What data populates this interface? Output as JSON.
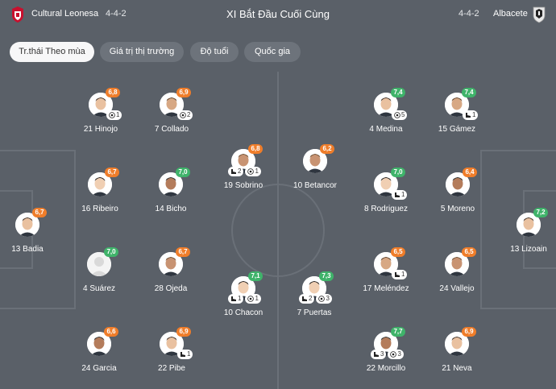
{
  "header": {
    "home_team": "Cultural Leonesa",
    "home_formation": "4-4-2",
    "title": "XI Bắt Đầu Cuối Cùng",
    "away_formation": "4-4-2",
    "away_team": "Albacete"
  },
  "tabs": [
    {
      "label": "Tr.thái Theo mùa",
      "active": true
    },
    {
      "label": "Giá trị thị trường",
      "active": false
    },
    {
      "label": "Độ tuổi",
      "active": false
    },
    {
      "label": "Quốc gia",
      "active": false
    }
  ],
  "colors": {
    "background": "#5a6068",
    "rating_orange": "#ef7d2a",
    "rating_green": "#3fb36a",
    "tab_active": "#f7f7f8",
    "tab_inactive": "#6d737b"
  },
  "home_players": [
    {
      "number_name": "21 Hinojo",
      "rating": "6,8",
      "rating_color": "orange",
      "badges": [
        {
          "icon": "ball-icon",
          "count": "1"
        }
      ]
    },
    {
      "number_name": "7 Collado",
      "rating": "6,9",
      "rating_color": "orange",
      "badges": [
        {
          "icon": "ball-icon",
          "count": "2"
        }
      ]
    },
    {
      "number_name": "19 Sobrino",
      "rating": "6,8",
      "rating_color": "orange",
      "badges": [
        {
          "icon": "boot-icon",
          "count": "2"
        },
        {
          "icon": "ball-icon",
          "count": "1"
        }
      ]
    },
    {
      "number_name": "16 Ribeiro",
      "rating": "6,7",
      "rating_color": "orange",
      "badges": []
    },
    {
      "number_name": "14 Bicho",
      "rating": "7,0",
      "rating_color": "green",
      "badges": []
    },
    {
      "number_name": "13 Badia",
      "rating": "6,7",
      "rating_color": "orange",
      "badges": []
    },
    {
      "number_name": "4 Suárez",
      "rating": "7,0",
      "rating_color": "green",
      "badges": []
    },
    {
      "number_name": "28 Ojeda",
      "rating": "6,7",
      "rating_color": "orange",
      "badges": []
    },
    {
      "number_name": "10 Chacon",
      "rating": "7,1",
      "rating_color": "green",
      "badges": [
        {
          "icon": "boot-icon",
          "count": "1"
        },
        {
          "icon": "ball-icon",
          "count": "1"
        }
      ]
    },
    {
      "number_name": "24 Garcia",
      "rating": "6,6",
      "rating_color": "orange",
      "badges": []
    },
    {
      "number_name": "22 Pibe",
      "rating": "6,9",
      "rating_color": "orange",
      "badges": [
        {
          "icon": "boot-icon",
          "count": "1"
        }
      ]
    }
  ],
  "away_players": [
    {
      "number_name": "4 Medina",
      "rating": "7,4",
      "rating_color": "green",
      "badges": [
        {
          "icon": "ball-icon",
          "count": "5"
        }
      ]
    },
    {
      "number_name": "15 Gámez",
      "rating": "7,4",
      "rating_color": "green",
      "badges": [
        {
          "icon": "boot-icon",
          "count": "1"
        }
      ]
    },
    {
      "number_name": "10 Betancor",
      "rating": "6,2",
      "rating_color": "orange",
      "badges": []
    },
    {
      "number_name": "8 Rodriguez",
      "rating": "7,0",
      "rating_color": "green",
      "badges": [
        {
          "icon": "boot-icon",
          "count": "1"
        }
      ]
    },
    {
      "number_name": "5 Moreno",
      "rating": "6,4",
      "rating_color": "orange",
      "badges": []
    },
    {
      "number_name": "13 Lizoain",
      "rating": "7,2",
      "rating_color": "green",
      "badges": []
    },
    {
      "number_name": "17 Meléndez",
      "rating": "6,5",
      "rating_color": "orange",
      "badges": [
        {
          "icon": "boot-icon",
          "count": "1"
        }
      ]
    },
    {
      "number_name": "24 Vallejo",
      "rating": "6,5",
      "rating_color": "orange",
      "badges": []
    },
    {
      "number_name": "7 Puertas",
      "rating": "7,3",
      "rating_color": "green",
      "badges": [
        {
          "icon": "boot-icon",
          "count": "2"
        },
        {
          "icon": "ball-icon",
          "count": "3"
        }
      ]
    },
    {
      "number_name": "22 Morcillo",
      "rating": "7,7",
      "rating_color": "green",
      "badges": [
        {
          "icon": "boot-icon",
          "count": "3"
        },
        {
          "icon": "ball-icon",
          "count": "3"
        }
      ]
    },
    {
      "number_name": "21 Neva",
      "rating": "6,9",
      "rating_color": "orange",
      "badges": []
    }
  ]
}
